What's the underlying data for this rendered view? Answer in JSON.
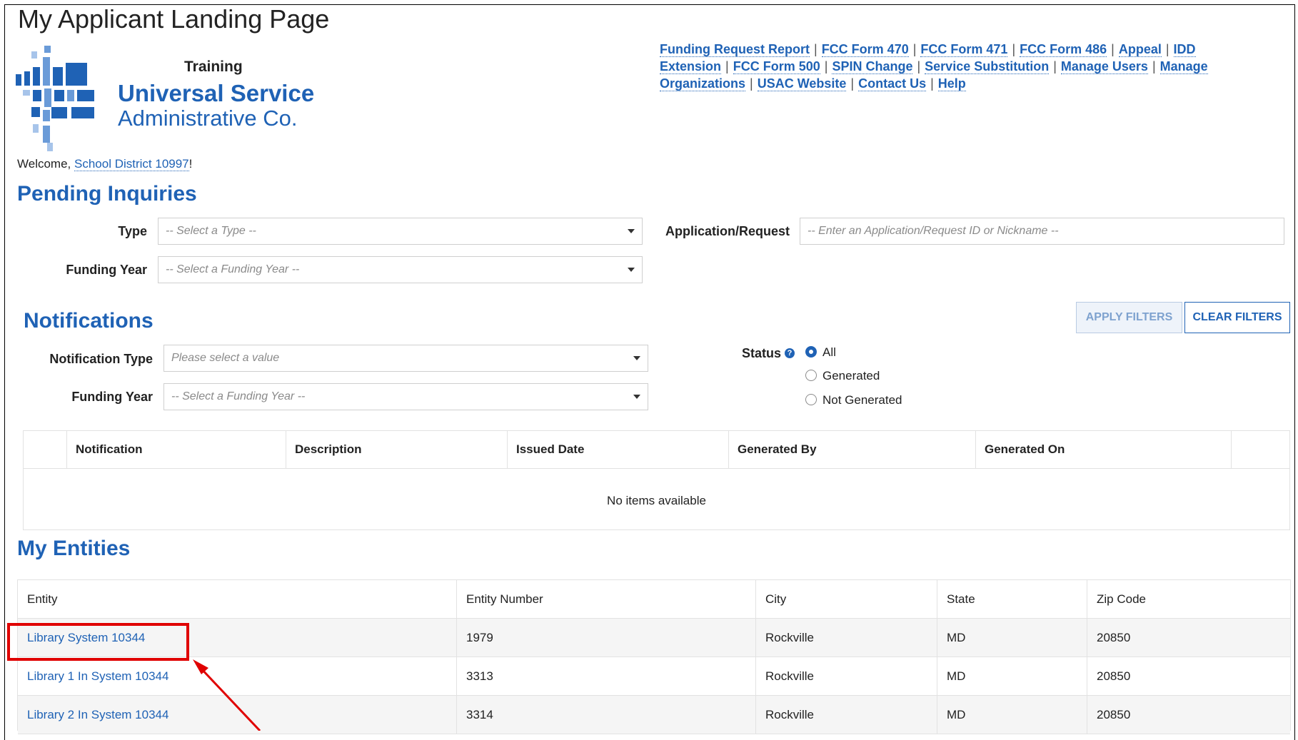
{
  "page": {
    "title": "My Applicant Landing Page"
  },
  "brand": {
    "training_label": "Training",
    "name_line1": "Universal Service",
    "name_line2": "Administrative Co.",
    "color": "#1f62b5"
  },
  "top_links": [
    "Funding Request Report",
    "FCC Form 470",
    "FCC Form 471",
    "FCC Form 486",
    "Appeal",
    "IDD Extension",
    "FCC Form 500",
    "SPIN Change",
    "Service Substitution",
    "Manage Users",
    "Manage Organizations",
    "USAC Website",
    "Contact Us",
    "Help"
  ],
  "welcome": {
    "prefix": "Welcome, ",
    "user": "School District 10997",
    "suffix": "!"
  },
  "pending_inquiries": {
    "title": "Pending Inquiries",
    "type_label": "Type",
    "type_placeholder": "-- Select a Type --",
    "funding_year_label": "Funding Year",
    "funding_year_placeholder": "-- Select a Funding Year --",
    "application_label": "Application/Request",
    "application_placeholder": "-- Enter an Application/Request ID or Nickname --"
  },
  "notifications": {
    "title": "Notifications",
    "apply_button": "APPLY FILTERS",
    "clear_button": "CLEAR FILTERS",
    "type_label": "Notification Type",
    "type_placeholder": "Please select a value",
    "funding_year_label": "Funding Year",
    "funding_year_placeholder": "-- Select a Funding Year --",
    "status_label": "Status",
    "status_options": [
      "All",
      "Generated",
      "Not Generated"
    ],
    "status_selected": "All",
    "columns": [
      "Notification",
      "Description",
      "Issued Date",
      "Generated By",
      "Generated On"
    ],
    "empty_text": "No items available"
  },
  "entities": {
    "title": "My Entities",
    "columns": [
      "Entity",
      "Entity Number",
      "City",
      "State",
      "Zip Code"
    ],
    "rows": [
      {
        "entity": "Library System 10344",
        "number": "1979",
        "city": "Rockville",
        "state": "MD",
        "zip": "20850"
      },
      {
        "entity": "Library 1 In System 10344",
        "number": "3313",
        "city": "Rockville",
        "state": "MD",
        "zip": "20850"
      },
      {
        "entity": "Library 2 In System 10344",
        "number": "3314",
        "city": "Rockville",
        "state": "MD",
        "zip": "20850"
      }
    ]
  },
  "annotation": {
    "highlight_color": "#e00000",
    "icon": "arrow-icon"
  }
}
